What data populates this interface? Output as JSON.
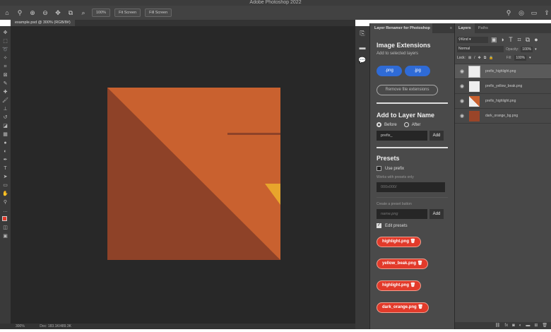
{
  "app": {
    "title": "Adobe Photoshop 2022"
  },
  "options": {
    "zoom_value": "100%",
    "fit_screen_1": "Fit Screen",
    "fit_screen_2": "Fill Screen"
  },
  "document": {
    "tab": "example.psd @ 300% (RGB/8#)",
    "zoom": "300%",
    "doc_size": "Doc: 183.1K/489.3K"
  },
  "colors": {
    "bg": "#c9612f",
    "dark": "#8e4228",
    "yellow": "#e8a52c",
    "accent": "#2f6bd6",
    "chip": "#e23a2a"
  },
  "plugin": {
    "title": "Layer Renamer for Photoshop",
    "image_extensions": {
      "heading": "Image Extensions",
      "sub": "Add to selected layers",
      "png": ".png",
      "jpg": ".jpg",
      "remove": "Remove file extensions"
    },
    "add_name": {
      "heading": "Add to Layer Name",
      "before": "Before",
      "after": "After",
      "value": "prefix_",
      "add": "Add"
    },
    "presets": {
      "heading": "Presets",
      "use_prefix": "Use prefix",
      "works_with": "Works with presets only",
      "pattern_placeholder": "000x000/",
      "create_label": "Create a preset button",
      "name_placeholder": "name.png",
      "add": "Add",
      "edit_presets": "Edit presets",
      "chips": [
        "highlight.png",
        "yellow_beak.png",
        "highlight.png",
        "dark_orange.png"
      ]
    }
  },
  "layers": {
    "tab_layers": "Layers",
    "tab_paths": "Paths",
    "kind": "Kind",
    "blend": "Normal",
    "opacity_label": "Opacity:",
    "opacity": "100%",
    "lock_label": "Lock:",
    "fill_label": "Fill:",
    "fill": "100%",
    "items": [
      "prefix_highlight.png",
      "prefix_yellow_beak.png",
      "prefix_highlight.png",
      "dark_orange_bg.png"
    ]
  }
}
